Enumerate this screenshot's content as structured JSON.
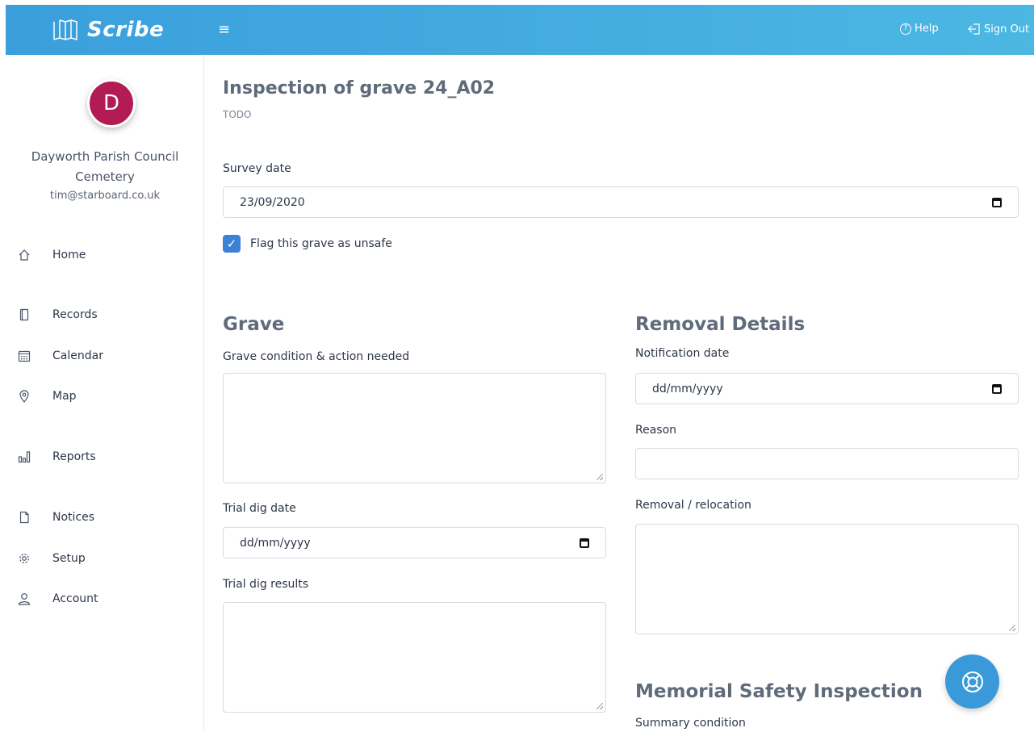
{
  "app": {
    "name": "Scribe"
  },
  "topbar": {
    "help_label": "Help",
    "signout_label": "Sign Out"
  },
  "profile": {
    "initial": "D",
    "org_line1": "Dayworth Parish Council",
    "org_line2": "Cemetery",
    "email": "tim@starboard.co.uk"
  },
  "nav": {
    "items": [
      {
        "label": "Home",
        "icon": "home-icon"
      },
      {
        "label": "Records",
        "icon": "book-icon"
      },
      {
        "label": "Calendar",
        "icon": "calendar-icon"
      },
      {
        "label": "Map",
        "icon": "map-pin-icon"
      },
      {
        "label": "Reports",
        "icon": "bar-chart-icon"
      },
      {
        "label": "Notices",
        "icon": "document-icon"
      },
      {
        "label": "Setup",
        "icon": "gear-icon"
      },
      {
        "label": "Account",
        "icon": "user-icon"
      }
    ]
  },
  "page": {
    "title": "Inspection of grave 24_A02",
    "subtitle": "TODO"
  },
  "form": {
    "survey_date_label": "Survey date",
    "survey_date_value": "23/09/2020",
    "unsafe_label": "Flag this grave as unsafe",
    "unsafe_checked": true,
    "grave": {
      "heading": "Grave",
      "condition_label": "Grave condition & action needed",
      "condition_value": "",
      "trial_dig_date_label": "Trial dig date",
      "trial_dig_date_placeholder": "dd/mm/yyyy",
      "trial_dig_results_label": "Trial dig results",
      "trial_dig_results_value": ""
    },
    "removal": {
      "heading": "Removal Details",
      "notification_date_label": "Notification date",
      "notification_date_placeholder": "dd/mm/yyyy",
      "reason_label": "Reason",
      "reason_value": "",
      "relocation_label": "Removal / relocation",
      "relocation_value": ""
    },
    "memorial": {
      "heading": "Memorial Safety Inspection",
      "summary_label": "Summary condition"
    }
  },
  "colors": {
    "topbar": "#3a9fdc",
    "avatar": "#b31b55",
    "accent": "#3b82d6",
    "fab": "#3a9ad9"
  }
}
